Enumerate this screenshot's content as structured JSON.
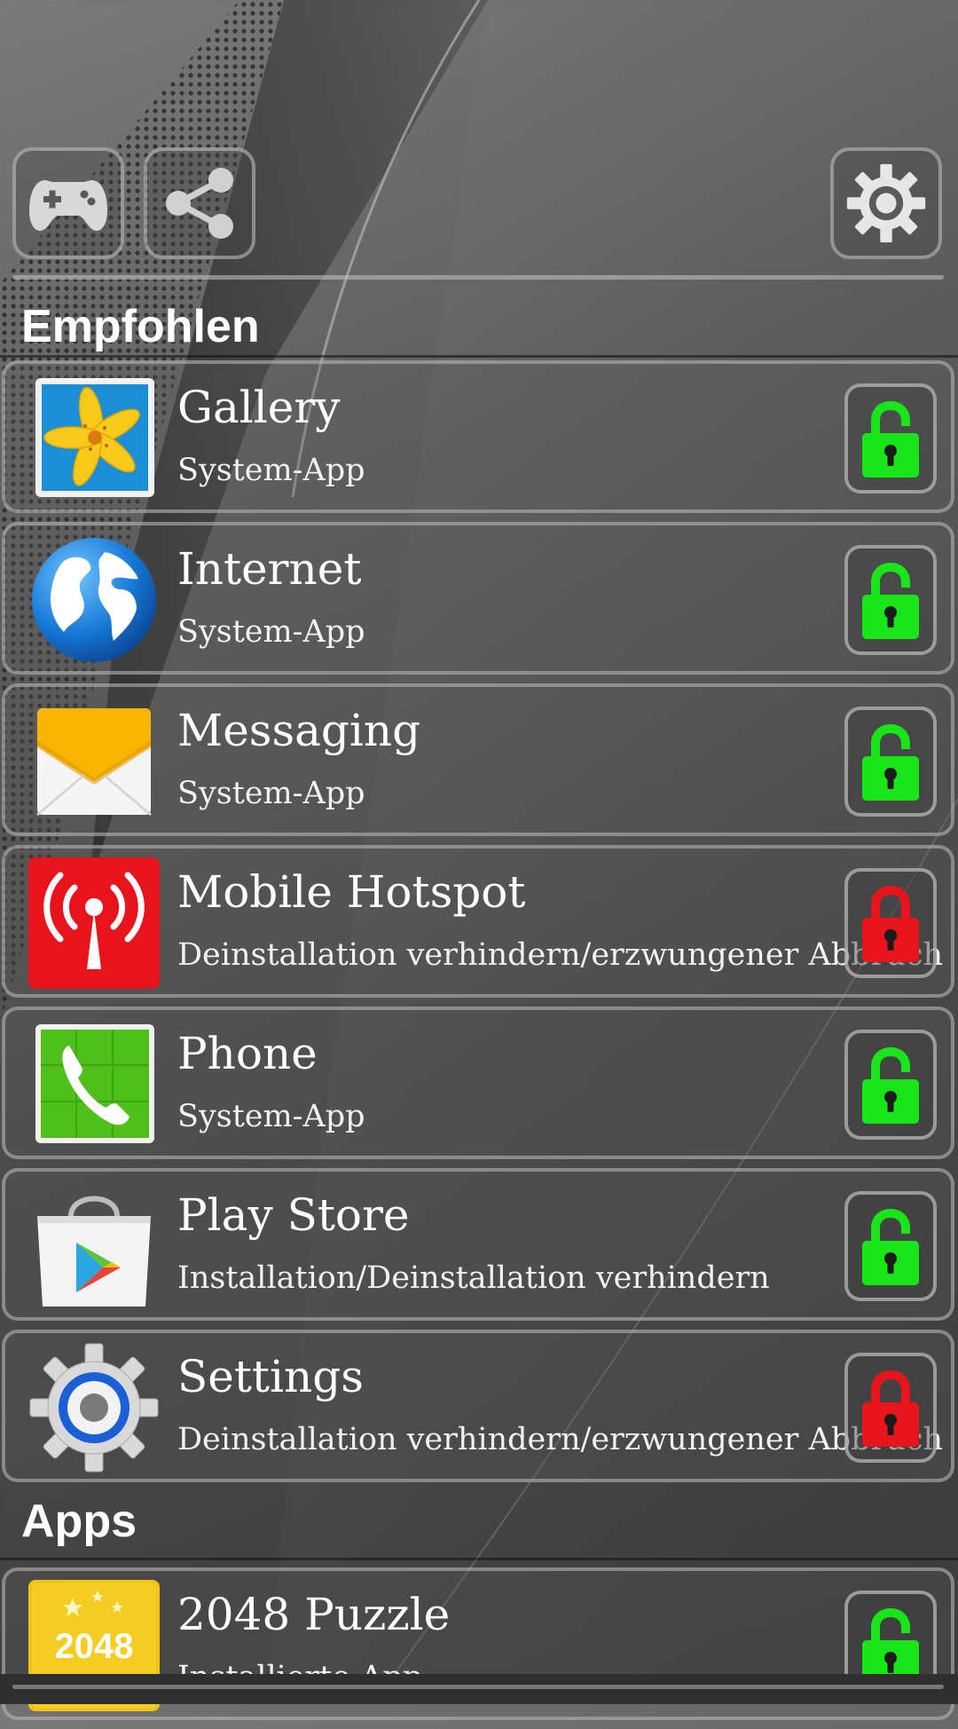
{
  "toolbar": {
    "games_icon": "gamepad-icon",
    "share_icon": "share-icon",
    "settings_icon": "gear-icon"
  },
  "sections": {
    "recommended_title": "Empfohlen",
    "apps_title": "Apps"
  },
  "recommended_apps": [
    {
      "name": "Gallery",
      "subtitle": "System-App",
      "icon": "gallery-icon",
      "locked": false
    },
    {
      "name": "Internet",
      "subtitle": "System-App",
      "icon": "globe-icon",
      "locked": false
    },
    {
      "name": "Messaging",
      "subtitle": "System-App",
      "icon": "envelope-icon",
      "locked": false
    },
    {
      "name": "Mobile Hotspot",
      "subtitle": "Deinstallation verhindern/erzwungener Abbruch",
      "icon": "hotspot-icon",
      "locked": true
    },
    {
      "name": "Phone",
      "subtitle": "System-App",
      "icon": "phone-icon",
      "locked": false
    },
    {
      "name": "Play Store",
      "subtitle": "Installation/Deinstallation verhindern",
      "icon": "play-store-icon",
      "locked": false
    },
    {
      "name": "Settings",
      "subtitle": "Deinstallation verhindern/erzwungener Abbruch",
      "icon": "settings-app-icon",
      "locked": true
    }
  ],
  "apps": [
    {
      "name": "2048 Puzzle",
      "subtitle": "Installierte App",
      "icon": "puzzle-2048-icon",
      "icon_text": "2048",
      "locked": false
    }
  ],
  "colors": {
    "unlocked": "#19e619",
    "locked": "#e8141c"
  }
}
